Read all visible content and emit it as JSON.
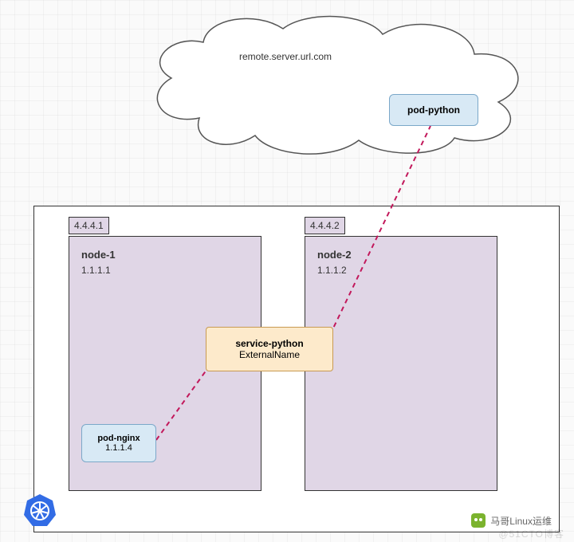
{
  "cloud": {
    "label": "remote.server.url.com"
  },
  "pods": {
    "python": {
      "name": "pod-python"
    },
    "nginx": {
      "name": "pod-nginx",
      "ip": "1.1.1.4"
    }
  },
  "service": {
    "name": "service-python",
    "type": "ExternalName"
  },
  "nodes": {
    "n1": {
      "tag": "4.4.4.1",
      "title": "node-1",
      "ip": "1.1.1.1"
    },
    "n2": {
      "tag": "4.4.4.2",
      "title": "node-2",
      "ip": "1.1.1.2"
    }
  },
  "badge": {
    "text": "马哥Linux运维"
  },
  "watermark": {
    "text": "@51CTO博客"
  },
  "colors": {
    "dash": "#c2185b",
    "nodeFill": "#e0d6e6",
    "serviceFill": "#fdeacb",
    "podFill": "#d8e9f5"
  }
}
